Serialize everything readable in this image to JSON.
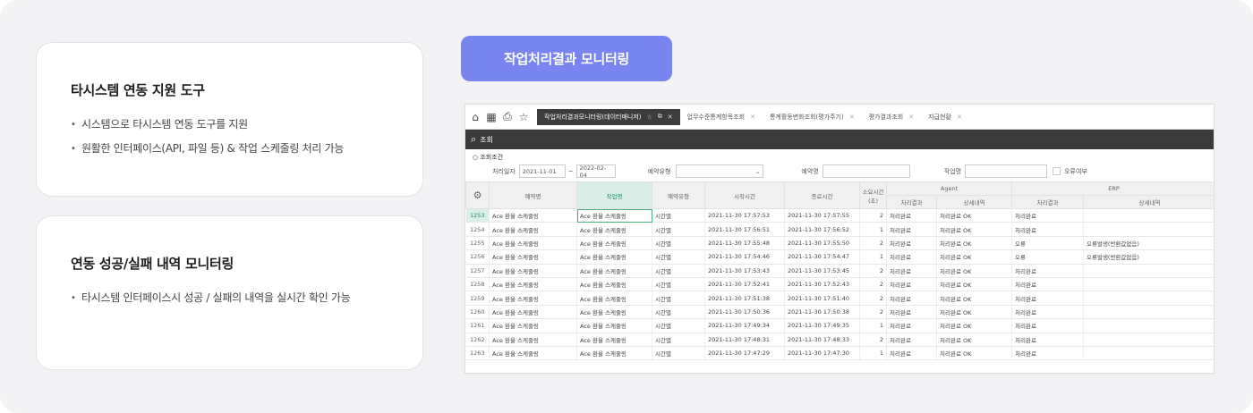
{
  "card1": {
    "title": "타시스템 연동 지원 도구",
    "bullets": [
      "시스템으로 타시스템 연동 도구를 지원",
      "원활한 인터페이스(API, 파일 등) & 작업 스케줄링 처리 가능"
    ]
  },
  "card2": {
    "title": "연동 성공/실패 내역 모니터링",
    "bullets": [
      "타시스템 인터페이스시 성공 / 실패의 내역을 실시간 확인 가능"
    ]
  },
  "pill_label": "작업처리결과 모니터링",
  "screen": {
    "toolbar_icons": [
      "home-icon",
      "calendar-icon",
      "printer-icon",
      "star-icon"
    ],
    "tabs": [
      {
        "label": "작업처리결과모니터링(데이터매니저)",
        "active": true
      },
      {
        "label": "업무수준통계항목조회",
        "active": false
      },
      {
        "label": "통계활동변화조회(평가주기)",
        "active": false
      },
      {
        "label": "평가결과조회",
        "active": false
      },
      {
        "label": "지급현황",
        "active": false
      }
    ],
    "search_label": "조회",
    "condition": {
      "title": "조회조건",
      "date_label": "처리일자",
      "date_from": "2021-11-01",
      "date_sep": "~",
      "date_to": "2022-02-04",
      "type_label": "예약유형",
      "name_label": "예약명",
      "job_label": "작업명",
      "error_label": "오류여부"
    },
    "table": {
      "headers": {
        "settings": "",
        "res_name": "예약명",
        "job_name": "작업명",
        "res_type": "예약유형",
        "start": "시작시간",
        "end": "종료시간",
        "duration": "소요시간(초)",
        "agent": "Agent",
        "erp": "ERP",
        "agent_result": "처리결과",
        "agent_detail": "상세내역",
        "erp_result": "처리결과",
        "erp_detail": "상세내역"
      },
      "rows": [
        {
          "no": "1253",
          "res": "Ace 환율 스케줄링",
          "job": "Ace 환율 스케줄링",
          "type": "시간별",
          "start": "2021-11-30 17:57:53",
          "end": "2021-11-30 17:57:55",
          "dur": "2",
          "ar": "처리완료",
          "ad": "처리완료 OK",
          "er": "처리완료",
          "ed": ""
        },
        {
          "no": "1254",
          "res": "Ace 환율 스케줄링",
          "job": "Ace 환율 스케줄링",
          "type": "시간별",
          "start": "2021-11-30 17:56:51",
          "end": "2021-11-30 17:56:52",
          "dur": "1",
          "ar": "처리완료",
          "ad": "처리완료 OK",
          "er": "처리완료",
          "ed": ""
        },
        {
          "no": "1255",
          "res": "Ace 환율 스케줄링",
          "job": "Ace 환율 스케줄링",
          "type": "시간별",
          "start": "2021-11-30 17:55:48",
          "end": "2021-11-30 17:55:50",
          "dur": "2",
          "ar": "처리완료",
          "ad": "처리완료 OK",
          "er": "오류",
          "ed": "오류발생(반환값없음)"
        },
        {
          "no": "1256",
          "res": "Ace 환율 스케줄링",
          "job": "Ace 환율 스케줄링",
          "type": "시간별",
          "start": "2021-11-30 17:54:46",
          "end": "2021-11-30 17:54:47",
          "dur": "1",
          "ar": "처리완료",
          "ad": "처리완료 OK",
          "er": "오류",
          "ed": "오류발생(반환값없음)"
        },
        {
          "no": "1257",
          "res": "Ace 환율 스케줄링",
          "job": "Ace 환율 스케줄링",
          "type": "시간별",
          "start": "2021-11-30 17:53:43",
          "end": "2021-11-30 17:53:45",
          "dur": "2",
          "ar": "처리완료",
          "ad": "처리완료 OK",
          "er": "처리완료",
          "ed": ""
        },
        {
          "no": "1258",
          "res": "Ace 환율 스케줄링",
          "job": "Ace 환율 스케줄링",
          "type": "시간별",
          "start": "2021-11-30 17:52:41",
          "end": "2021-11-30 17:52:43",
          "dur": "2",
          "ar": "처리완료",
          "ad": "처리완료 OK",
          "er": "처리완료",
          "ed": ""
        },
        {
          "no": "1259",
          "res": "Ace 환율 스케줄링",
          "job": "Ace 환율 스케줄링",
          "type": "시간별",
          "start": "2021-11-30 17:51:38",
          "end": "2021-11-30 17:51:40",
          "dur": "2",
          "ar": "처리완료",
          "ad": "처리완료 OK",
          "er": "처리완료",
          "ed": ""
        },
        {
          "no": "1260",
          "res": "Ace 환율 스케줄링",
          "job": "Ace 환율 스케줄링",
          "type": "시간별",
          "start": "2021-11-30 17:50:36",
          "end": "2021-11-30 17:50:38",
          "dur": "2",
          "ar": "처리완료",
          "ad": "처리완료 OK",
          "er": "처리완료",
          "ed": ""
        },
        {
          "no": "1261",
          "res": "Ace 환율 스케줄링",
          "job": "Ace 환율 스케줄링",
          "type": "시간별",
          "start": "2021-11-30 17:49:34",
          "end": "2021-11-30 17:49:35",
          "dur": "1",
          "ar": "처리완료",
          "ad": "처리완료 OK",
          "er": "처리완료",
          "ed": ""
        },
        {
          "no": "1262",
          "res": "Ace 환율 스케줄링",
          "job": "Ace 환율 스케줄링",
          "type": "시간별",
          "start": "2021-11-30 17:48:31",
          "end": "2021-11-30 17:48:33",
          "dur": "2",
          "ar": "처리완료",
          "ad": "처리완료 OK",
          "er": "처리완료",
          "ed": ""
        },
        {
          "no": "1263",
          "res": "Ace 환율 스케줄링",
          "job": "Ace 환율 스케줄링",
          "type": "시간별",
          "start": "2021-11-30 17:47:29",
          "end": "2021-11-30 17:47:30",
          "dur": "1",
          "ar": "처리완료",
          "ad": "처리완료 OK",
          "er": "처리완료",
          "ed": ""
        }
      ]
    }
  },
  "colors": {
    "accent": "#7884f0",
    "dark_bar": "#3a3a3a",
    "selected": "#d9eee6"
  }
}
